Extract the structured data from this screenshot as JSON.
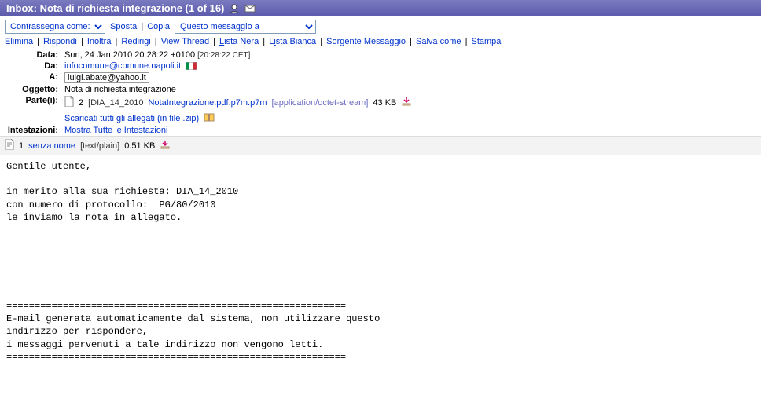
{
  "header": {
    "title": "Inbox: Nota di richiesta integrazione (1 of 16)"
  },
  "toolbar": {
    "mark_as_label": "Contrassegna come:",
    "move_label": "Sposta",
    "copy_label": "Copia",
    "move_select": "Questo messaggio a"
  },
  "actions": {
    "elimina": "Elimina",
    "rispondi": "Rispondi",
    "inoltra": "Inoltra",
    "redirigi": "Redirigi",
    "viewthread": "View Thread",
    "listanera": "Lista Nera",
    "listabianca": "Lista Bianca",
    "sorgente": "Sorgente Messaggio",
    "salvacome": "Salva come",
    "stampa": "Stampa"
  },
  "fields": {
    "date_label": "Data:",
    "date_value": "Sun, 24 Jan 2010 20:28:22 +0100",
    "date_local": "[20:28:22 CET]",
    "from_label": "Da:",
    "from_value": "infocomune@comune.napoli.it",
    "to_label": "A:",
    "to_value": "luigi.abate@yahoo.it",
    "subject_label": "Oggetto:",
    "subject_value": "Nota di richiesta integrazione",
    "parts_label": "Parte(i):",
    "att_index": "2",
    "att_name_prefix": "[DIA_14_2010",
    "att_filename": "NotaIntegrazione.pdf.p7m.p7m",
    "att_mime": "[application/octet-stream]",
    "att_size": "43 KB",
    "download_all": "Scaricati tutti gli allegati (in file .zip)",
    "intest_label": "Intestazioni:",
    "show_all_headers": "Mostra Tutte le Intestazioni"
  },
  "part_row": {
    "index": "1",
    "name": "senza nome",
    "mime": "[text/plain]",
    "size": "0.51 KB"
  },
  "body": "Gentile utente,\n\nin merito alla sua richiesta: DIA_14_2010\ncon numero di protocollo:  PG/80/2010\nle inviamo la nota in allegato.\n\n\n\n\n\n\n============================================================\nE-mail generata automaticamente dal sistema, non utilizzare questo\nindirizzo per rispondere,\ni messaggi pervenuti a tale indirizzo non vengono letti.\n============================================================"
}
